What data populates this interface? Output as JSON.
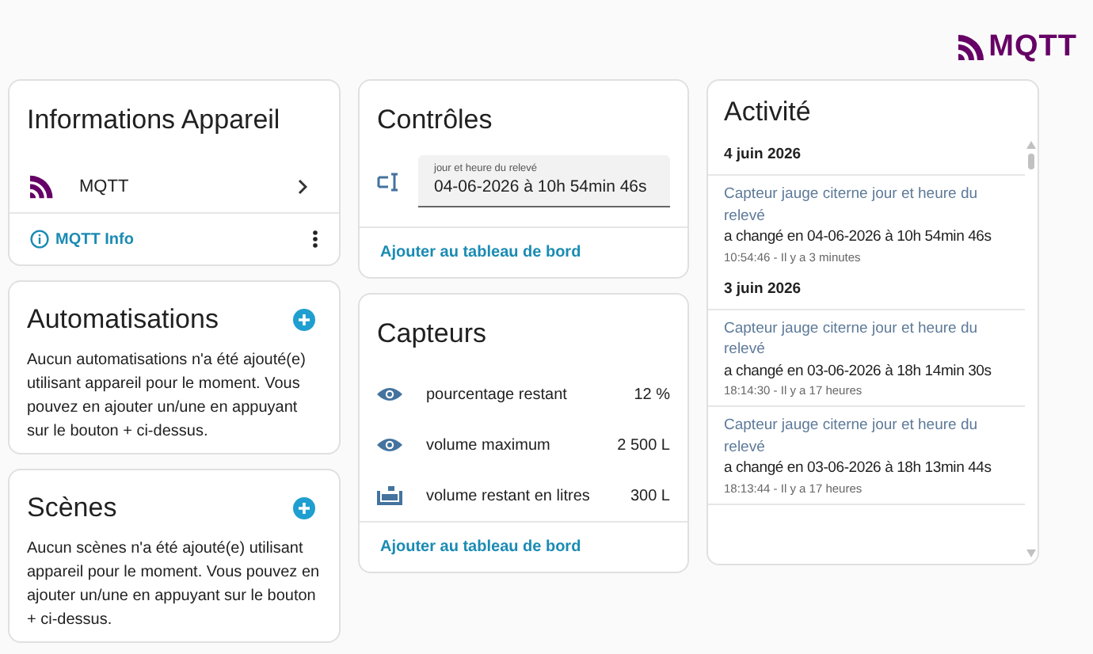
{
  "logo": {
    "text": "MQTT"
  },
  "device_info": {
    "title": "Informations Appareil",
    "integration": "MQTT",
    "info_link": "MQTT Info"
  },
  "automations": {
    "title": "Automatisations",
    "text": "Aucun automatisations n'a été ajouté(e) utilisant appareil pour le moment. Vous pouvez en ajouter un/une en appuyant sur le bouton + ci-dessus."
  },
  "scenes": {
    "title": "Scènes",
    "text": "Aucun scènes n'a été ajouté(e) utilisant appareil pour le moment. Vous pouvez en ajouter un/une en appuyant sur le bouton + ci-dessus."
  },
  "controls": {
    "title": "Contrôles",
    "field": {
      "label": "jour et heure du relevé",
      "value": "04-06-2026 à 10h 54min 46s"
    },
    "link": "Ajouter au tableau de bord"
  },
  "sensors": {
    "title": "Capteurs",
    "rows": [
      {
        "kind": "eye",
        "name": "pourcentage restant",
        "value": "12 %"
      },
      {
        "kind": "eye",
        "name": "volume maximum",
        "value": "2 500 L"
      },
      {
        "kind": "tank",
        "name": "volume restant en litres",
        "value": "300 L"
      }
    ],
    "link": "Ajouter au tableau de bord"
  },
  "activity": {
    "title": "Activité",
    "groups": [
      {
        "date": "4 juin 2026",
        "entries": [
          {
            "entity": "Capteur jauge citerne jour et heure du relevé",
            "change": "a changé en 04-06-2026 à 10h 54min 46s",
            "time": "10:54:46 - Il y a 3 minutes"
          }
        ]
      },
      {
        "date": "3 juin 2026",
        "entries": [
          {
            "entity": "Capteur jauge citerne jour et heure du relevé",
            "change": "a changé en 03-06-2026 à 18h 14min 30s",
            "time": "18:14:30 - Il y a 17 heures"
          },
          {
            "entity": "Capteur jauge citerne jour et heure du relevé",
            "change": "a changé en 03-06-2026 à 18h 13min 44s",
            "time": "18:13:44 - Il y a 17 heures"
          }
        ]
      }
    ]
  }
}
